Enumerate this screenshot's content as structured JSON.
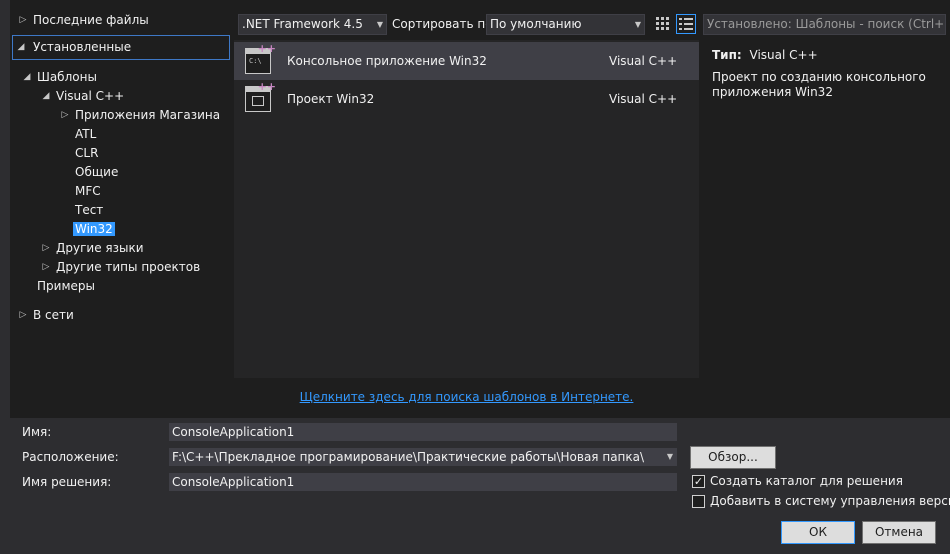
{
  "tree": {
    "recent": "Последние файлы",
    "installed": "Установленные",
    "templates": "Шаблоны",
    "visual_cpp": "Visual C++",
    "store_apps": "Приложения Магазина",
    "atl": "ATL",
    "clr": "CLR",
    "general": "Общие",
    "mfc": "MFC",
    "test": "Тест",
    "win32": "Win32",
    "other_languages": "Другие языки",
    "other_project_types": "Другие типы проектов",
    "samples": "Примеры",
    "online": "В сети"
  },
  "toolbar": {
    "framework": ".NET Framework 4.5",
    "sort_label": "Сортировать по:",
    "sort_value": "По умолчанию",
    "search_placeholder": "Установлено: Шаблоны - поиск (Ctrl+"
  },
  "templates": [
    {
      "name": "Консольное приложение Win32",
      "lang": "Visual C++",
      "icon_text": "C:\\"
    },
    {
      "name": "Проект Win32",
      "lang": "Visual C++"
    }
  ],
  "online_link": "Щелкните здесь для поиска шаблонов в Интернете.",
  "details": {
    "type_label": "Тип:",
    "type_value": "Visual C++",
    "description": "Проект по созданию консольного приложения Win32"
  },
  "form": {
    "name_label": "Имя:",
    "name_value": "ConsoleApplication1",
    "location_label": "Расположение:",
    "location_value": "F:\\C++\\Прекладное програмирование\\Практические работы\\Новая папка\\",
    "solution_label": "Имя решения:",
    "solution_value": "ConsoleApplication1",
    "browse": "Обзор...",
    "create_dir": "Создать каталог для решения",
    "add_vcs": "Добавить в систему управления версиями",
    "ok": "ОК",
    "cancel": "Отмена"
  },
  "colors": {
    "accent": "#3399ff",
    "background": "#1e1e1e",
    "panel": "#252526",
    "selected_row": "#3f3f46"
  }
}
